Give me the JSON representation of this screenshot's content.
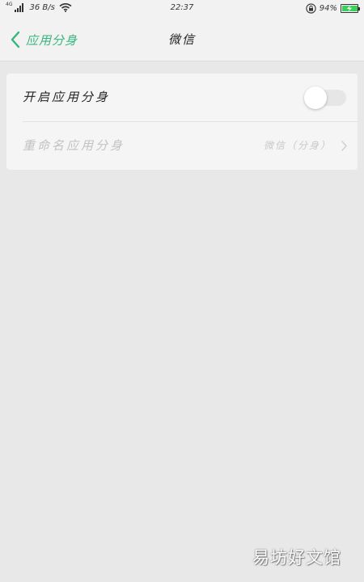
{
  "status_bar": {
    "network_type": "4G",
    "speed": "36 B/s",
    "time": "22:37",
    "battery_percent": "94%",
    "battery_level": 0.94,
    "battery_color": "#3ad15a",
    "icons": [
      "signal-icon",
      "wifi-icon",
      "rotation-lock-icon",
      "battery-charging-icon"
    ]
  },
  "nav": {
    "back_label": "应用分身",
    "title": "微信",
    "accent_color": "#35b57c"
  },
  "settings": {
    "enable_clone": {
      "label": "开启应用分身",
      "enabled": false
    },
    "rename_clone": {
      "label": "重命名应用分身",
      "value": "微信（分身）",
      "disabled": true
    }
  },
  "watermark": "易坊好文馆"
}
